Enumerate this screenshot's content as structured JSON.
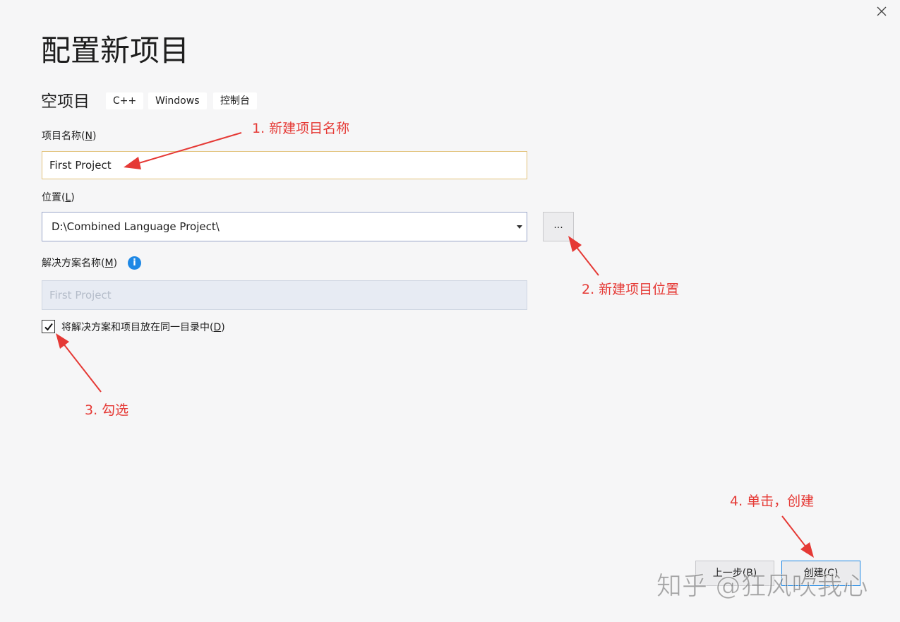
{
  "title": "配置新项目",
  "template": {
    "name": "空项目",
    "tags": [
      "C++",
      "Windows",
      "控制台"
    ]
  },
  "fields": {
    "project_name": {
      "label": "项目名称",
      "mnemonic": "N",
      "value": "First Project"
    },
    "location": {
      "label": "位置",
      "mnemonic": "L",
      "value": "D:\\Combined Language Project\\",
      "browse_label": "..."
    },
    "solution_name": {
      "label": "解决方案名称",
      "mnemonic": "M",
      "value": "First Project"
    },
    "same_dir": {
      "label": "将解决方案和项目放在同一目录中",
      "mnemonic": "D",
      "checked": true
    }
  },
  "buttons": {
    "back": "上一步(B)",
    "create": "创建(C)"
  },
  "annotations": [
    "1. 新建项目名称",
    "2. 新建项目位置",
    "3. 勾选",
    "4. 单击，创建"
  ],
  "watermark": "知乎 @狂风吹我心",
  "colors": {
    "annotation": "#e53935",
    "accent": "#1e88e5",
    "background": "#f6f6f7"
  },
  "icons": {
    "close": "close-icon",
    "info": "info-icon",
    "dropdown": "chevron-down-icon",
    "check": "checkmark-icon"
  }
}
